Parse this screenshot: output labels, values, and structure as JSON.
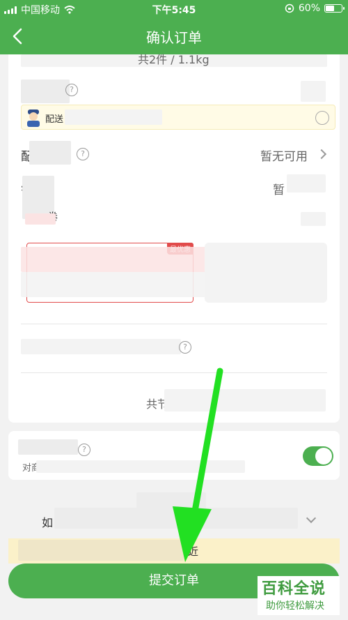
{
  "status": {
    "carrier": "中国移动",
    "time": "下午5:45",
    "battery": "60%",
    "battery_level": 0.6
  },
  "nav": {
    "title": "确认订单"
  },
  "order": {
    "count_weight": "共2件 / 1.1kg",
    "courier_label": "配送",
    "delivery_label": "配",
    "delivery_value": "暂无可用",
    "row3_label": "钅",
    "row3_value": "暂",
    "row4_label": "卷",
    "coupon_tag": "最优惠",
    "total_label": "共节"
  },
  "points": {
    "label": "对商"
  },
  "footer": {
    "remark_prefix": "如",
    "notice_suffix": "近",
    "submit_label": "提交订单"
  },
  "watermark": {
    "title": "百科全说",
    "subtitle": "助你轻松解决"
  },
  "colors": {
    "brand_green": "#4caf50",
    "coupon_red": "#e14b4b",
    "arrow_green": "#22e022"
  }
}
